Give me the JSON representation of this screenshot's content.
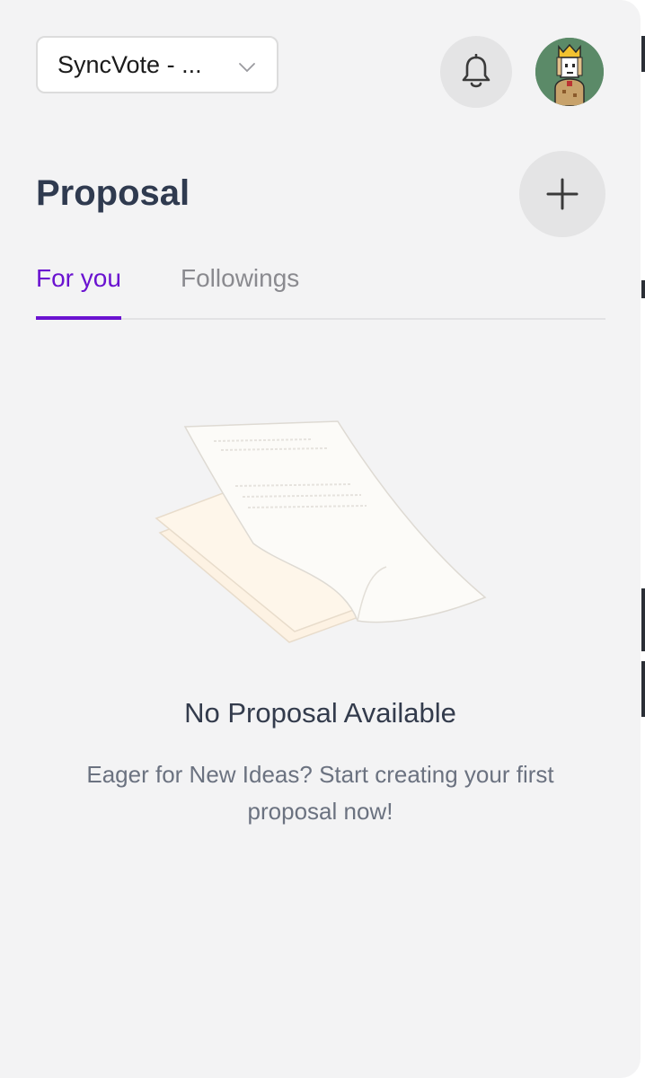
{
  "header": {
    "dao_selector": {
      "value": "SyncVote - ..."
    },
    "notifications_label": "",
    "avatar_alt": ""
  },
  "page": {
    "title": "Proposal",
    "add_button_label": ""
  },
  "tabs": [
    {
      "label": "For you",
      "active": true
    },
    {
      "label": "Followings",
      "active": false
    }
  ],
  "empty_state": {
    "title": "No Proposal Available",
    "description": "Eager for New Ideas? Start creating your first proposal now!"
  },
  "colors": {
    "accent": "#6a12d0",
    "title_text": "#2f3a4f",
    "panel_bg": "#f3f3f4",
    "avatar_bg": "#5b8a68"
  },
  "icons": [
    "chevron-down-icon",
    "bell-icon",
    "plus-icon",
    "documents-illustration"
  ]
}
